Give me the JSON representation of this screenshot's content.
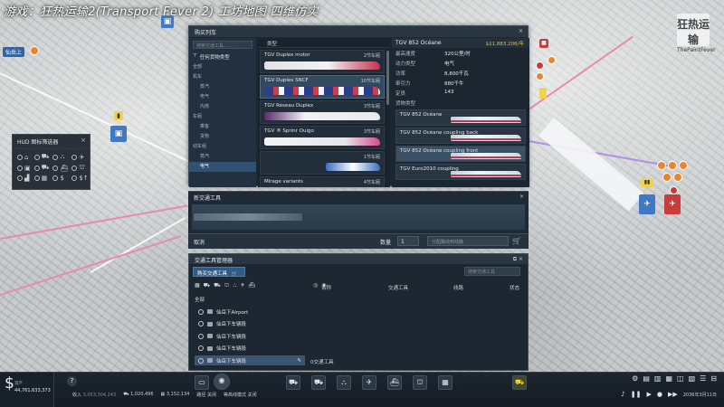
{
  "caption": "游戏：狂热运输2(Transport Fever 2) 工坊地图 四维仿实",
  "logo": {
    "brand": "狂热运输",
    "sub": "ThePaintFever"
  },
  "world": {
    "town_label": "仙岳上"
  },
  "hud": {
    "title": "HUD 图标筛选器",
    "close": "×"
  },
  "buy_dialog": {
    "title": "购买列车",
    "close": "×",
    "search_placeholder": "搜索交通工具……",
    "filter_label": "任何货物类型",
    "categories": [
      {
        "label": "全部",
        "sub": false
      },
      {
        "label": "机车",
        "sub": false
      },
      {
        "label": "蒸汽",
        "sub": true
      },
      {
        "label": "电气",
        "sub": true
      },
      {
        "label": "内燃",
        "sub": true
      },
      {
        "label": "车厢",
        "sub": false
      },
      {
        "label": "乘客",
        "sub": true
      },
      {
        "label": "货物",
        "sub": true
      },
      {
        "label": "动车组",
        "sub": false
      },
      {
        "label": "蒸汽",
        "sub": true
      },
      {
        "label": "电气",
        "sub": true
      }
    ],
    "type_header": "类型",
    "vehicles": [
      {
        "name": "TGV Duplex motor",
        "count": "2节车厢"
      },
      {
        "name": "TGV Duplex SNCF",
        "count": "10节车厢"
      },
      {
        "name": "TGV Réseau Duplex",
        "count": "3节车厢"
      },
      {
        "name": "TGV ® Sprinr Ouigo",
        "count": "3节车厢"
      },
      {
        "name": "",
        "count": "1节车厢"
      },
      {
        "name": "Mirage variants",
        "count": "4节车厢"
      }
    ],
    "selected": {
      "name": "TGV 852 Océane",
      "price": "$11,883,206/年"
    },
    "specs": [
      {
        "k": "最高速度",
        "v": "320公里/时"
      },
      {
        "k": "动力类型",
        "v": "电气"
      },
      {
        "k": "功率",
        "v": "8,800千瓦"
      },
      {
        "k": "牵引力",
        "v": "880千牛"
      },
      {
        "k": "定员",
        "v": "143"
      },
      {
        "k": "货物类型",
        "v": ""
      }
    ],
    "variants": [
      {
        "label": "TGV 852 Océane"
      },
      {
        "label": "TGV 852 Océane coupling back"
      },
      {
        "label": "TGV 852 Océane coupling front"
      },
      {
        "label": "TGV Euro2010 coupling"
      }
    ],
    "new_vehicle_title": "新交通工具",
    "new_vehicle_close": "×",
    "cancel": "取消",
    "quantity_label": "数量",
    "quantity": "1",
    "assign_placeholder": "分配路线到线路",
    "cart_icon": "cart-icon"
  },
  "manager": {
    "title": "交通工具管理器",
    "buy_button": "购买交通工具",
    "search_placeholder": "搜索交通工具",
    "columns": {
      "name": "名称",
      "vehicle": "交通工具",
      "line": "线路",
      "status": "状态"
    },
    "all_label": "全部",
    "rows": [
      {
        "label": "仙岳下Airport",
        "selected": false
      },
      {
        "label": "仙岳下车辆段",
        "selected": false
      },
      {
        "label": "仙岳下车辆段",
        "selected": false
      },
      {
        "label": "仙岳下车辆段",
        "selected": false
      },
      {
        "label": "仙岳下车辆段",
        "selected": true
      }
    ],
    "count_label": "0交通工具"
  },
  "bottom": {
    "money_label": "资产",
    "money_value": "44,761,633,373",
    "income_label": "收入",
    "income_value": "3,053,304,243",
    "vehicles_value": "1,020,496",
    "cargo_value": "3,152,134",
    "toggle1": "路径",
    "toggle1_state": "关闭",
    "toggle2": "等高线模式",
    "toggle2_state": "关闭",
    "date": "2036年3月11日"
  }
}
